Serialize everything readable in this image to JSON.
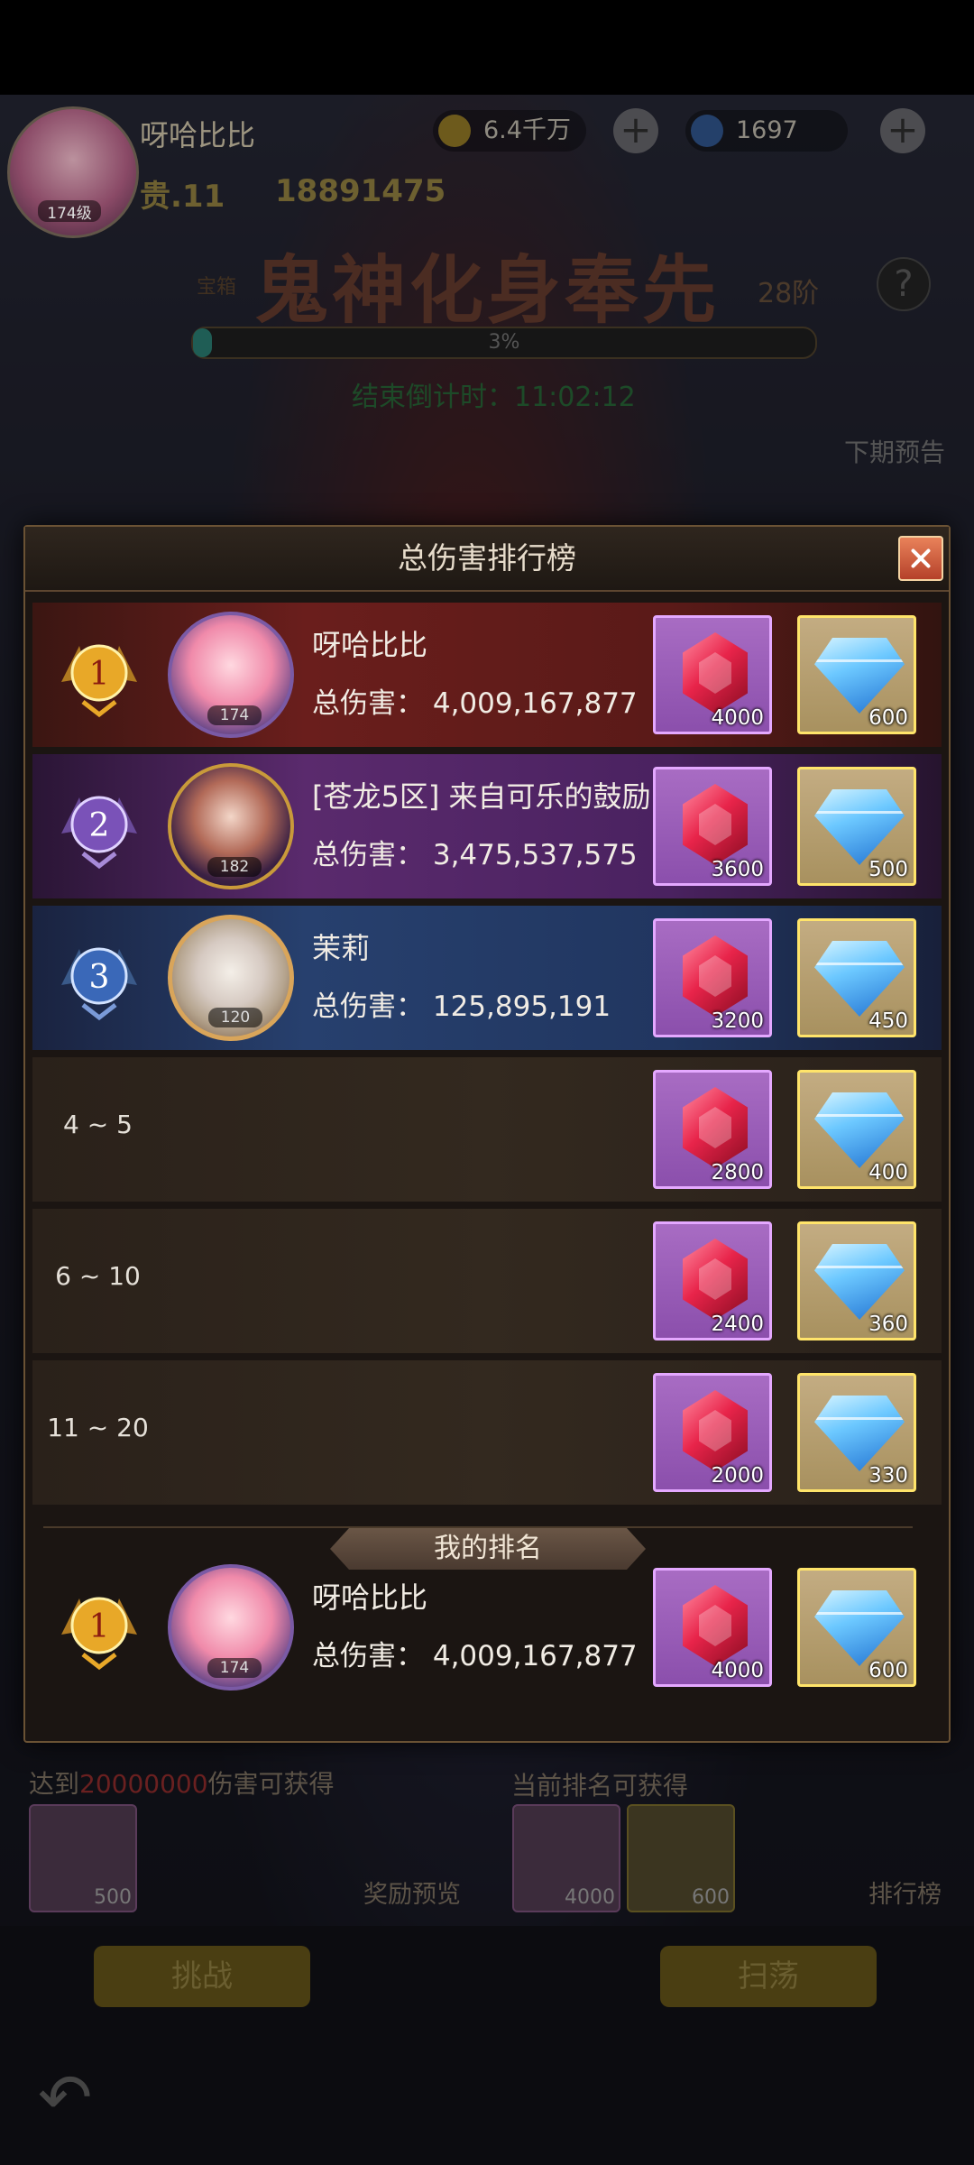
{
  "header": {
    "player_name": "呀哈比比",
    "avatar_level": "174级",
    "vip_label": "贵.11",
    "power": "18891475",
    "gold_value": "6.4千万",
    "diamond_value": "1697"
  },
  "boss": {
    "tag": "宝箱",
    "title": "鬼神化身奉先",
    "stage": "28阶",
    "progress_label": "3%",
    "progress_value": 0.03,
    "countdown": "结束倒计时：11:02:12",
    "next_preview": "下期预告"
  },
  "background_panel": {
    "threshold_prefix": "达到",
    "threshold_value": "20000000",
    "threshold_suffix": "伤害可获得",
    "current_rank_label": "当前排名可获得",
    "reward_preview": "奖励预览",
    "leaderboard": "排行榜",
    "threshold_reward_count": "500",
    "current_reward_ruby": "4000",
    "current_reward_diamond": "600",
    "challenge_button": "挑战",
    "sweep_button": "扫荡"
  },
  "modal": {
    "title": "总伤害排行榜",
    "rows": [
      {
        "rank": "1",
        "name": "呀哈比比",
        "avatar_level": "174",
        "damage": "总伤害： 4,009,167,877",
        "ruby": "4000",
        "diamond": "600"
      },
      {
        "rank": "2",
        "name": "[苍龙5区] 来自可乐的鼓励",
        "avatar_level": "182",
        "damage": "总伤害： 3,475,537,575",
        "ruby": "3600",
        "diamond": "500"
      },
      {
        "rank": "3",
        "name": "茉莉",
        "avatar_level": "120",
        "damage": "总伤害： 125,895,191",
        "ruby": "3200",
        "diamond": "450"
      },
      {
        "rank_range": "4 ~ 5",
        "ruby": "2800",
        "diamond": "400"
      },
      {
        "rank_range": "6 ~ 10",
        "ruby": "2400",
        "diamond": "360"
      },
      {
        "rank_range": "11 ~ 20",
        "ruby": "2000",
        "diamond": "330"
      }
    ],
    "my_rank_label": "我的排名",
    "my_rank": {
      "rank": "1",
      "name": "呀哈比比",
      "avatar_level": "174",
      "damage": "总伤害： 4,009,167,877",
      "ruby": "4000",
      "diamond": "600"
    }
  },
  "colors": {
    "rank1_bg": "#6a1e1c",
    "rank2_bg": "#5a2a6d",
    "rank3_bg": "#27406e",
    "ruby_frame": "#e4a8ff",
    "diamond_frame": "#ffe46a"
  }
}
